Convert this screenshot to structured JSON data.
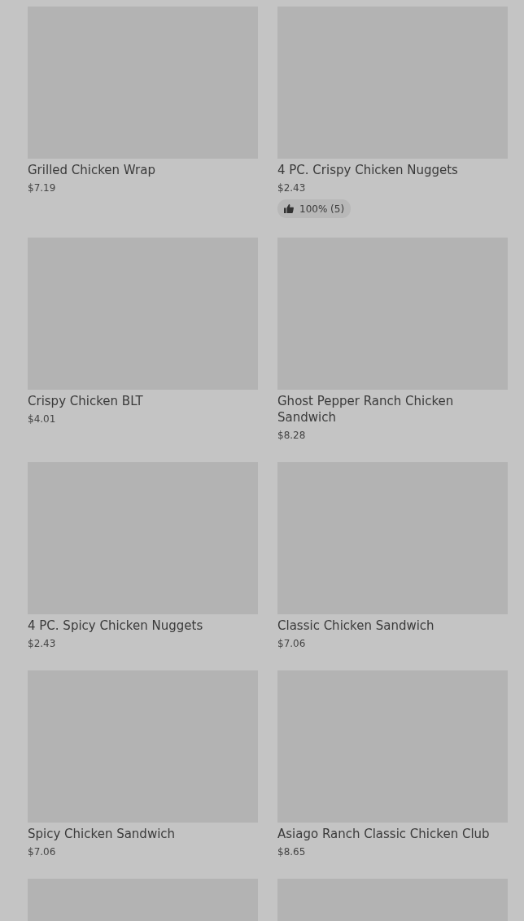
{
  "items": [
    {
      "kind": "card",
      "name": "Grilled Chicken Wrap",
      "price": "$7.19"
    },
    {
      "kind": "card",
      "name": "4 PC. Crispy Chicken Nuggets",
      "price": "$2.43",
      "rating": "100% (5)"
    },
    {
      "kind": "card",
      "name": "Crispy Chicken BLT",
      "price": "$4.01"
    },
    {
      "kind": "card",
      "name": "Ghost Pepper Ranch Chicken Sandwich",
      "price": "$8.28"
    },
    {
      "kind": "card",
      "name": "4 PC. Spicy Chicken Nuggets",
      "price": "$2.43"
    },
    {
      "kind": "card",
      "name": "Classic Chicken Sandwich",
      "price": "$7.06"
    },
    {
      "kind": "card",
      "name": "Spicy Chicken Sandwich",
      "price": "$7.06"
    },
    {
      "kind": "card",
      "name": "Asiago Ranch Classic Chicken Club",
      "price": "$8.65"
    },
    {
      "kind": "placeholder"
    },
    {
      "kind": "placeholder"
    }
  ]
}
